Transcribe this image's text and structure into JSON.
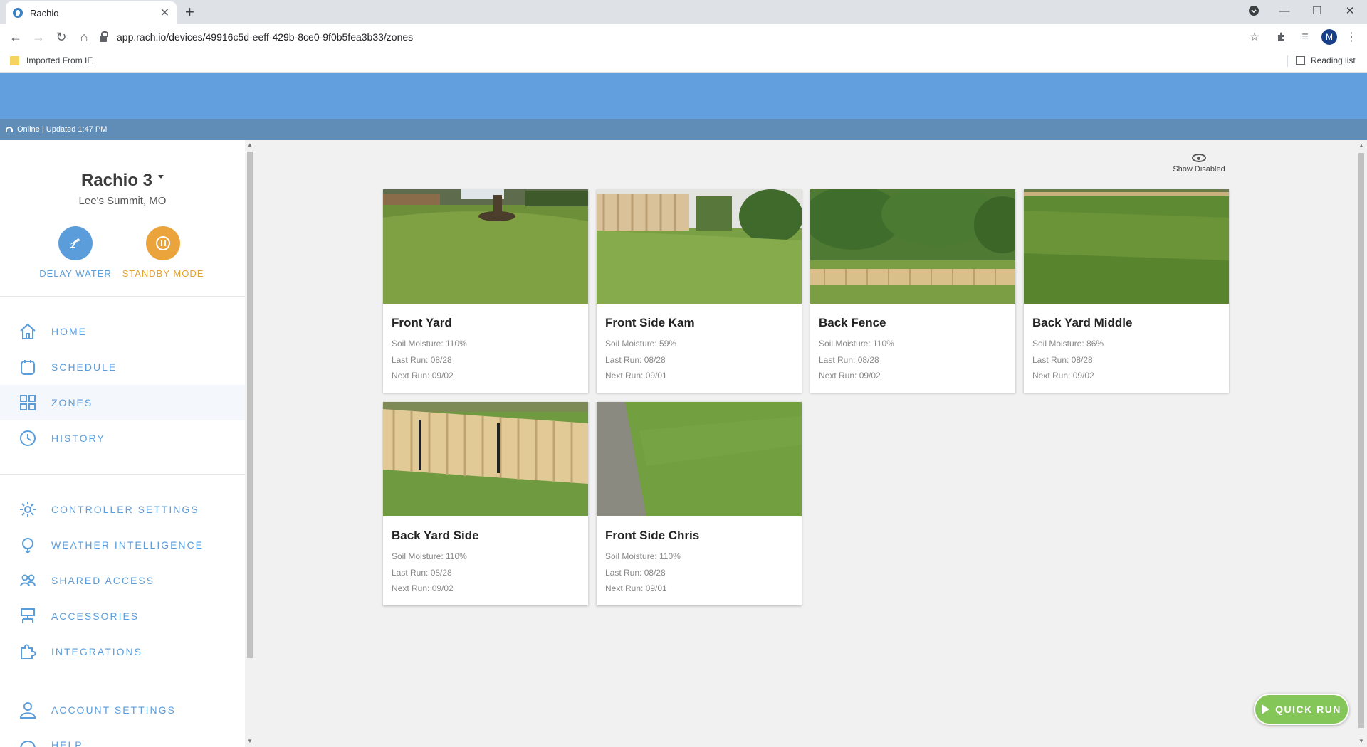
{
  "browser": {
    "tab_title": "Rachio",
    "url": "app.rach.io/devices/49916c5d-eeff-429b-8ce0-9f0b5fea3b33/zones",
    "bookmark_folder": "Imported From IE",
    "reading_list": "Reading list",
    "profile_initial": "M"
  },
  "header": {
    "status_text": "Online | Updated 1:47 PM",
    "banner_color": "#629fde"
  },
  "sidebar": {
    "device_name": "Rachio 3",
    "device_location": "Lee's Summit, MO",
    "delay_water_label": "DELAY WATER",
    "standby_mode_label": "STANDBY MODE",
    "nav_items": [
      {
        "label": "HOME",
        "icon": "home-icon"
      },
      {
        "label": "SCHEDULE",
        "icon": "calendar-icon"
      },
      {
        "label": "ZONES",
        "icon": "grid-icon",
        "active": true
      },
      {
        "label": "HISTORY",
        "icon": "clock-icon"
      }
    ],
    "settings_items": [
      {
        "label": "CONTROLLER SETTINGS",
        "icon": "gear-icon"
      },
      {
        "label": "WEATHER INTELLIGENCE",
        "icon": "weather-icon"
      },
      {
        "label": "SHARED ACCESS",
        "icon": "people-icon"
      },
      {
        "label": "ACCESSORIES",
        "icon": "accessories-icon"
      },
      {
        "label": "INTEGRATIONS",
        "icon": "puzzle-icon"
      }
    ],
    "account_items": [
      {
        "label": "ACCOUNT SETTINGS",
        "icon": "person-icon"
      },
      {
        "label": "HELP",
        "icon": "help-icon"
      }
    ],
    "accent_color": "#5b9ddb",
    "standby_color": "#eba33c"
  },
  "main": {
    "show_disabled_label": "Show Disabled",
    "quick_run_label": "QUICK RUN",
    "zones": [
      {
        "name": "Front Yard",
        "soil_moisture": "Soil Moisture: 110%",
        "last_run": "Last Run: 08/28",
        "next_run": "Next Run: 09/02"
      },
      {
        "name": "Front Side Kam",
        "soil_moisture": "Soil Moisture: 59%",
        "last_run": "Last Run: 08/28",
        "next_run": "Next Run: 09/01"
      },
      {
        "name": "Back Fence",
        "soil_moisture": "Soil Moisture: 110%",
        "last_run": "Last Run: 08/28",
        "next_run": "Next Run: 09/02"
      },
      {
        "name": "Back Yard Middle",
        "soil_moisture": "Soil Moisture: 86%",
        "last_run": "Last Run: 08/28",
        "next_run": "Next Run: 09/02"
      },
      {
        "name": "Back Yard Side",
        "soil_moisture": "Soil Moisture: 110%",
        "last_run": "Last Run: 08/28",
        "next_run": "Next Run: 09/02"
      },
      {
        "name": "Front Side Chris",
        "soil_moisture": "Soil Moisture: 110%",
        "last_run": "Last Run: 08/28",
        "next_run": "Next Run: 09/01"
      }
    ],
    "quick_run_color": "#84c657"
  }
}
